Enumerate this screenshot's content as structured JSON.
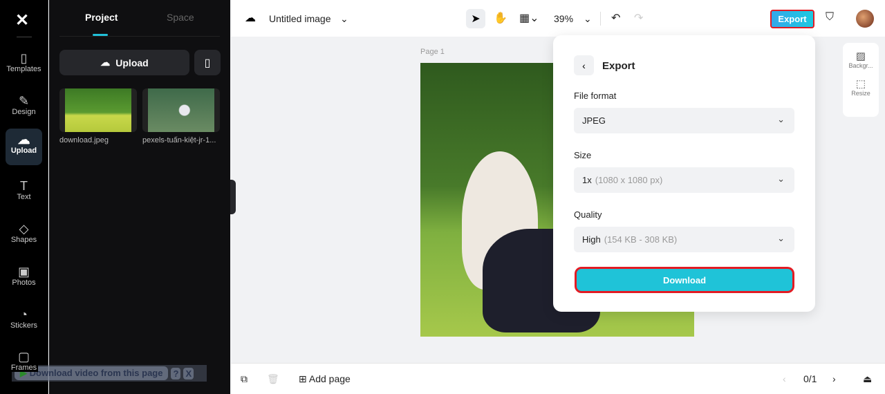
{
  "rail": {
    "items": [
      {
        "label": "Templates",
        "icon": "templates-icon"
      },
      {
        "label": "Design",
        "icon": "design-icon"
      },
      {
        "label": "Upload",
        "icon": "upload-cloud-icon"
      },
      {
        "label": "Text",
        "icon": "text-icon"
      },
      {
        "label": "Shapes",
        "icon": "shapes-icon"
      },
      {
        "label": "Photos",
        "icon": "photos-icon"
      },
      {
        "label": "Stickers",
        "icon": "stickers-icon"
      },
      {
        "label": "Frames",
        "icon": "frames-icon"
      }
    ]
  },
  "panel": {
    "tabs": [
      "Project",
      "Space"
    ],
    "upload_label": "Upload",
    "files": [
      "download.jpeg",
      "pexels-tuấn-kiệt-jr-1..."
    ]
  },
  "extension_bar": {
    "label": "Download video from this page",
    "help": "?",
    "close": "X"
  },
  "topbar": {
    "title": "Untitled image",
    "zoom": "39%",
    "export_label": "Export"
  },
  "canvas": {
    "page_label": "Page 1"
  },
  "side_tools": [
    {
      "label": "Backgr..."
    },
    {
      "label": "Resize"
    }
  ],
  "bottombar": {
    "add_page": "Add page",
    "page_counter": "0/1"
  },
  "export_modal": {
    "title": "Export",
    "file_format_label": "File format",
    "file_format": "JPEG",
    "size_label": "Size",
    "size_value": "1x",
    "size_detail": "(1080 x 1080 px)",
    "quality_label": "Quality",
    "quality_value": "High",
    "quality_detail": "(154 KB - 308 KB)",
    "download_label": "Download"
  },
  "colors": {
    "accent": "#1fc3d8",
    "highlight": "#e31b23"
  }
}
